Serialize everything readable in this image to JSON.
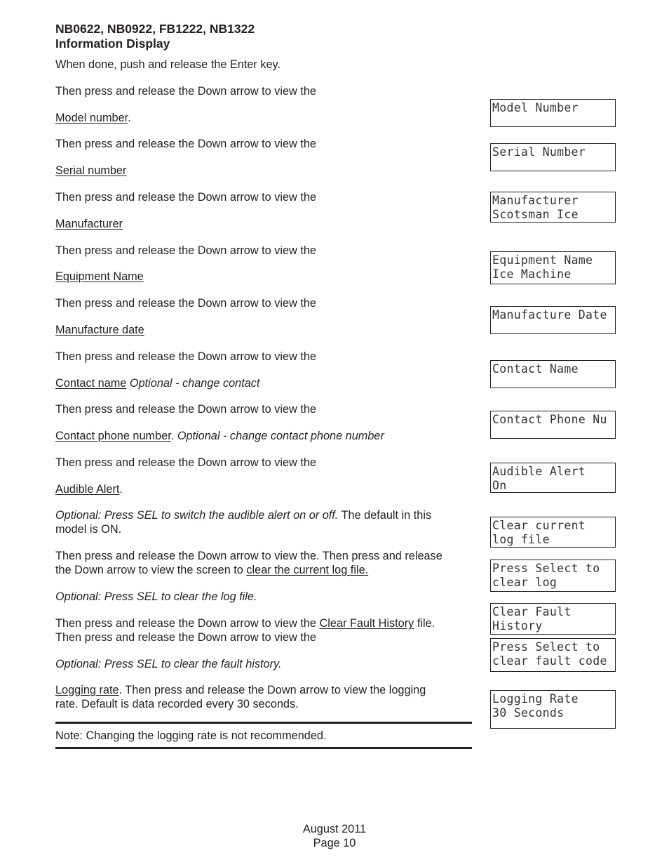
{
  "header": {
    "models": "NB0622, NB0922, FB1222, NB1322",
    "section": "Information Display"
  },
  "steps": {
    "intro": "When done, push and release the Enter key.",
    "then_down": "Then press and release the Down arrow to view the",
    "model": {
      "link": "Model number",
      "suffix": "."
    },
    "serial": {
      "link": "Serial number"
    },
    "manufacturer": {
      "link": "Manufacturer"
    },
    "equipment": {
      "link": "Equipment Name"
    },
    "manufacture_date": {
      "link": "Manufacture date"
    },
    "contact_name": {
      "link": "Contact name",
      "optional": "Optional - change contact"
    },
    "contact_phone": {
      "link": "Contact phone number",
      "sep": ".",
      "optional": "Optional - change contact phone number"
    },
    "audible": {
      "link": "Audible Alert",
      "suffix": "."
    },
    "audible_optional": {
      "italic": "Optional: Press SEL to switch the audible alert on or off.",
      "rest": " The default in this",
      "line2": "model is ON."
    },
    "clear_log": {
      "line1": "Then press and release the Down arrow to view the. Then press and release",
      "line2_prefix": "the Down arrow to view the screen to ",
      "link": "clear the current log file."
    },
    "clear_log_optional": "Optional: Press SEL to clear the log file.",
    "fault": {
      "prefix": "Then press and release the Down arrow to view the ",
      "link": "Clear Fault History",
      "suffix": " file.",
      "line2": "Then press and release the Down arrow to view the"
    },
    "fault_optional": "Optional: Press SEL to clear the fault history.",
    "logging": {
      "link": "Logging rate",
      "rest": ". Then press and release the Down arrow to view the logging",
      "line2": "rate. Default is data recorded every 30 seconds."
    },
    "note": "Note: Changing the logging rate is not recommended."
  },
  "lcd_screens": [
    {
      "line1": "Model Number",
      "line2": ""
    },
    {
      "line1": "Serial Number",
      "line2": ""
    },
    {
      "line1": "Manufacturer",
      "line2": "Scotsman Ice"
    },
    {
      "line1": "Equipment Name",
      "line2": "Ice Machine"
    },
    {
      "line1": "Manufacture Date",
      "line2": ""
    },
    {
      "line1": "Contact Name",
      "line2": ""
    },
    {
      "line1": "Contact Phone Nu",
      "line2": ""
    },
    {
      "line1": "Audible Alert",
      "line2": "On"
    },
    {
      "line1": "Clear current",
      "line2": "log file"
    },
    {
      "line1": "Press Select to",
      "line2": "clear log"
    },
    {
      "line1": "Clear Fault",
      "line2": "History"
    },
    {
      "line1": "Press Select to",
      "line2": "clear fault code"
    },
    {
      "line1": "Logging Rate",
      "line2": "30 Seconds"
    }
  ],
  "footer": {
    "date": "August 2011",
    "page": "Page 10"
  }
}
